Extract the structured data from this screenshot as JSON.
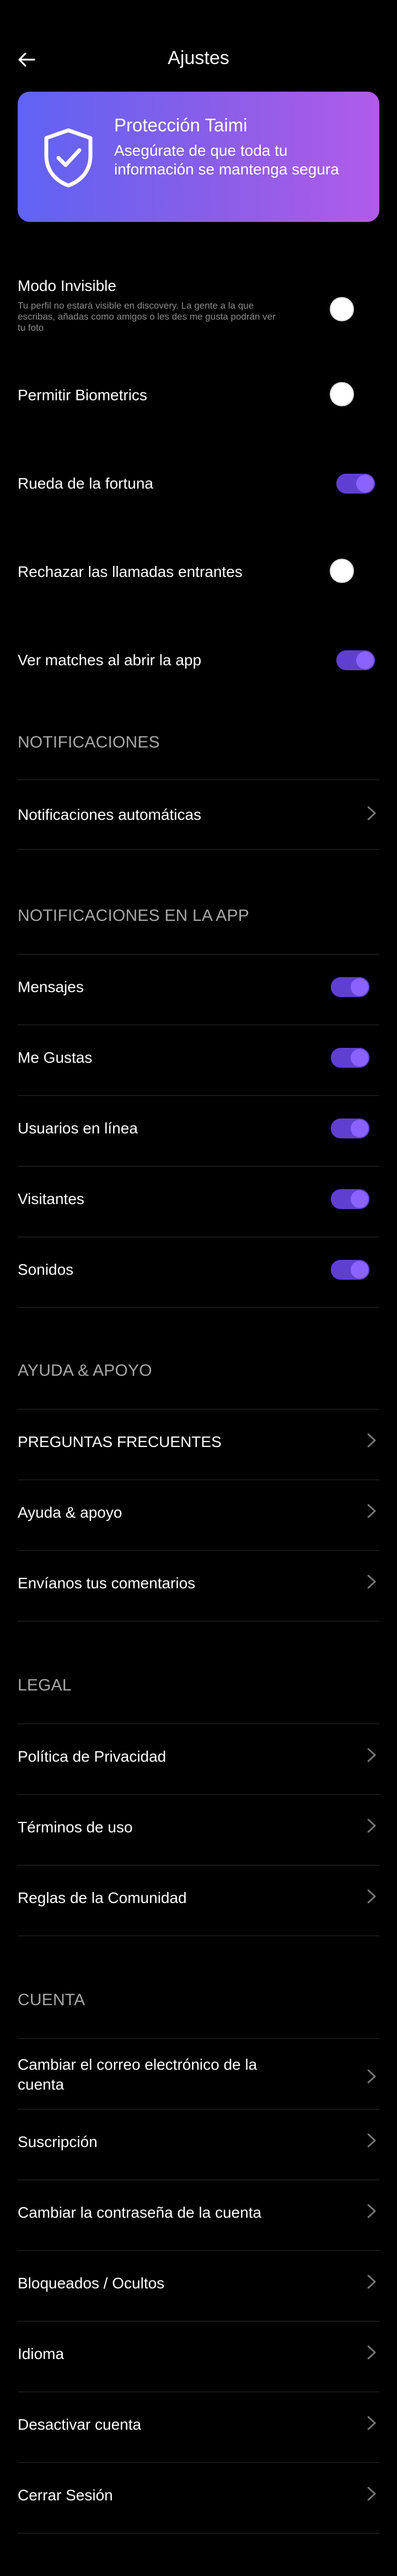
{
  "header": {
    "title": "Ajustes"
  },
  "banner": {
    "title": "Protección Taimi",
    "text": "Asegúrate de que toda tu información se mantenga segura"
  },
  "privacy": {
    "invisible_mode": {
      "label": "Modo Invisible",
      "desc": "Tu perfil no estará visible en discovery. La gente a la que escribas, añadas como amigos o les des me gusta podrán ver tu foto",
      "on": false
    },
    "biometrics": {
      "label": "Permitir Biometrics",
      "on": false
    },
    "wheel": {
      "label": "Rueda de la fortuna",
      "on": true
    },
    "reject_calls": {
      "label": "Rechazar las llamadas entrantes",
      "on": false
    },
    "matches": {
      "label": "Ver matches al abrir la app",
      "on": true
    }
  },
  "notifications": {
    "header": "NOTIFICACIONES",
    "auto": "Notificaciones automáticas"
  },
  "in_app": {
    "header": "NOTIFICACIONES EN LA APP",
    "items": [
      {
        "label": "Mensajes",
        "on": true
      },
      {
        "label": "Me Gustas",
        "on": true
      },
      {
        "label": "Usuarios en línea",
        "on": true
      },
      {
        "label": "Visitantes",
        "on": true
      },
      {
        "label": "Sonidos",
        "on": true
      }
    ]
  },
  "help": {
    "header": "AYUDA & APOYO",
    "items": [
      "PREGUNTAS FRECUENTES",
      "Ayuda & apoyo",
      "Envíanos tus comentarios"
    ]
  },
  "legal": {
    "header": "LEGAL",
    "items": [
      "Política de Privacidad",
      "Términos de uso",
      "Reglas de la Comunidad"
    ]
  },
  "account": {
    "header": "CUENTA",
    "items": [
      "Cambiar el correo electrónico de la cuenta",
      "Suscripción",
      "Cambiar la contraseña de la cuenta",
      "Bloqueados / Ocultos",
      "Idioma",
      "Desactivar cuenta",
      "Cerrar Sesión"
    ]
  },
  "colors": {
    "accent": "#7c55f0",
    "banner_start": "#5f63f4",
    "banner_end": "#b15bea"
  },
  "icons": {
    "back": "arrow-left-icon",
    "shield": "shield-check-icon",
    "chevron": "chevron-right-icon"
  }
}
